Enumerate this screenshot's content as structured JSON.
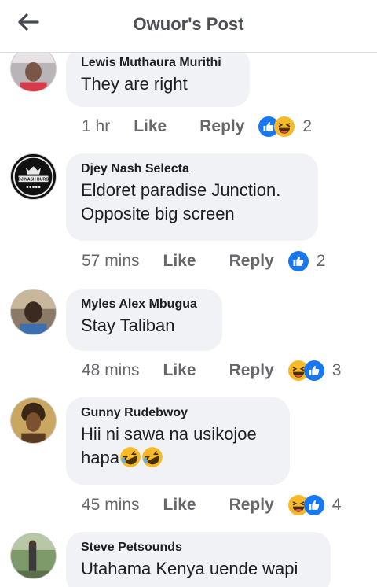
{
  "header": {
    "title": "Owuor's Post"
  },
  "colors": {
    "like_blue": "#1877f2",
    "haha_yellow": "#f7b928",
    "muted": "#65676b"
  },
  "actions": {
    "like_label": "Like",
    "reply_label": "Reply"
  },
  "comments": [
    {
      "author": "Lewis Muthaura Murithi",
      "lines": [
        "They are right"
      ],
      "time": "1 hr",
      "reactions": [
        "like",
        "haha"
      ],
      "reaction_count": "2"
    },
    {
      "author": "Djey Nash Selecta",
      "lines": [
        "Eldoret paradise Junction.",
        "Opposite big screen"
      ],
      "time": "57 mins",
      "reactions": [
        "like"
      ],
      "reaction_count": "2",
      "avatar_text": "DJ NASH BURC"
    },
    {
      "author": "Myles Alex Mbugua",
      "lines": [
        "Stay Taliban"
      ],
      "time": "48 mins",
      "reactions": [
        "haha",
        "like"
      ],
      "reaction_count": "3"
    },
    {
      "author": "Gunny Rudebwoy",
      "lines": [
        "Hii ni sawa na usikojoe",
        "hapa"
      ],
      "time": "45 mins",
      "reactions": [
        "haha",
        "like"
      ],
      "reaction_count": "4"
    },
    {
      "author": "Steve Petsounds",
      "lines": [
        "Utahama Kenya uende wapi"
      ],
      "time": "",
      "reactions": [],
      "reaction_count": ""
    }
  ]
}
